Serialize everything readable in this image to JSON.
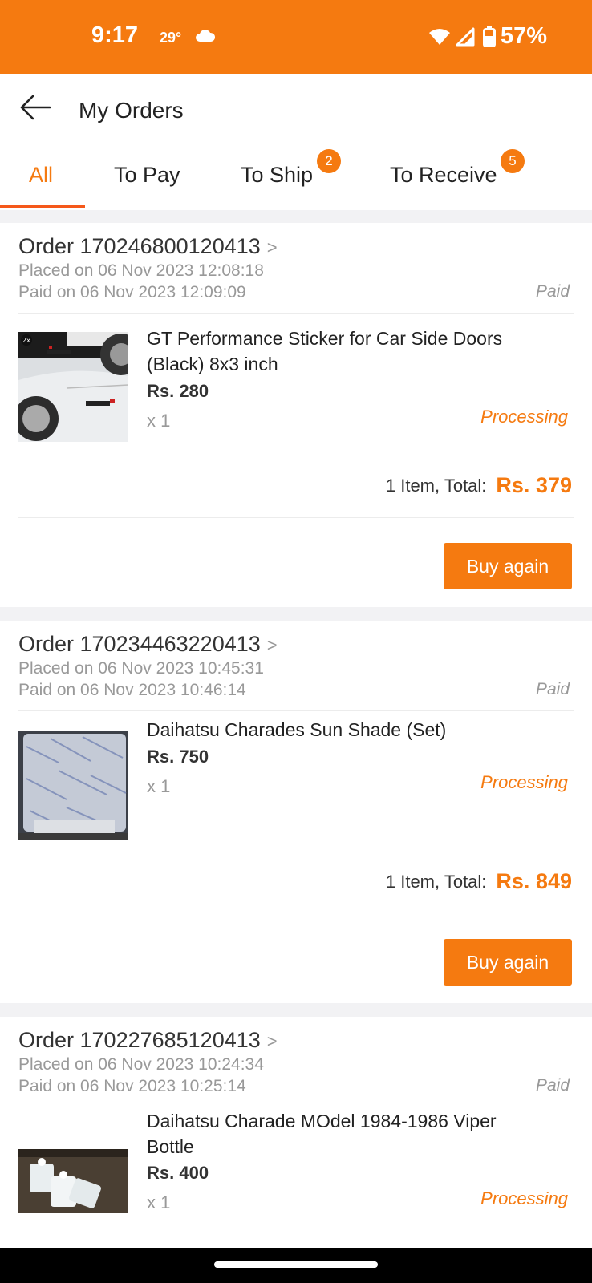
{
  "status_bar": {
    "time": "9:17",
    "temperature": "29°",
    "weather_icon": "cloud-icon",
    "battery": "57%",
    "bg_color": "#f57a10"
  },
  "header": {
    "title": "My Orders",
    "back_icon": "arrow-left-icon"
  },
  "tabs": [
    {
      "label": "All",
      "active": true
    },
    {
      "label": "To Pay"
    },
    {
      "label": "To Ship",
      "badge": "2"
    },
    {
      "label": "To Receive",
      "badge": "5"
    }
  ],
  "accent_color": "#f57a10",
  "orders": [
    {
      "order_label": "Order 170246800120413",
      "chevron": ">",
      "placed": "Placed on 06 Nov 2023  12:08:18",
      "paid_on": "Paid on 06 Nov 2023  12:09:09",
      "payment_status": "Paid",
      "item": {
        "name": "GT Performance Sticker for Car Side Doors (Black) 8x3 inch",
        "price": "Rs. 280",
        "qty": "x 1",
        "status": "Processing",
        "thumb_badge": "2x"
      },
      "total_label": "1 Item, Total:",
      "total_amount": "Rs. 379",
      "button": "Buy again"
    },
    {
      "order_label": "Order 170234463220413",
      "chevron": ">",
      "placed": "Placed on 06 Nov 2023  10:45:31",
      "paid_on": "Paid on 06 Nov 2023  10:46:14",
      "payment_status": "Paid",
      "item": {
        "name": "Daihatsu Charades Sun Shade (Set)",
        "price": "Rs. 750",
        "qty": "x 1",
        "status": "Processing"
      },
      "total_label": "1 Item, Total:",
      "total_amount": "Rs. 849",
      "button": "Buy again"
    },
    {
      "order_label": "Order 170227685120413",
      "chevron": ">",
      "placed": "Placed on 06 Nov 2023  10:24:34",
      "paid_on": "Paid on 06 Nov 2023  10:25:14",
      "payment_status": "Paid",
      "item": {
        "name": "Daihatsu Charade MOdel 1984-1986 Viper Bottle",
        "price": "Rs. 400",
        "qty": "x 1",
        "status": "Processing"
      }
    }
  ]
}
